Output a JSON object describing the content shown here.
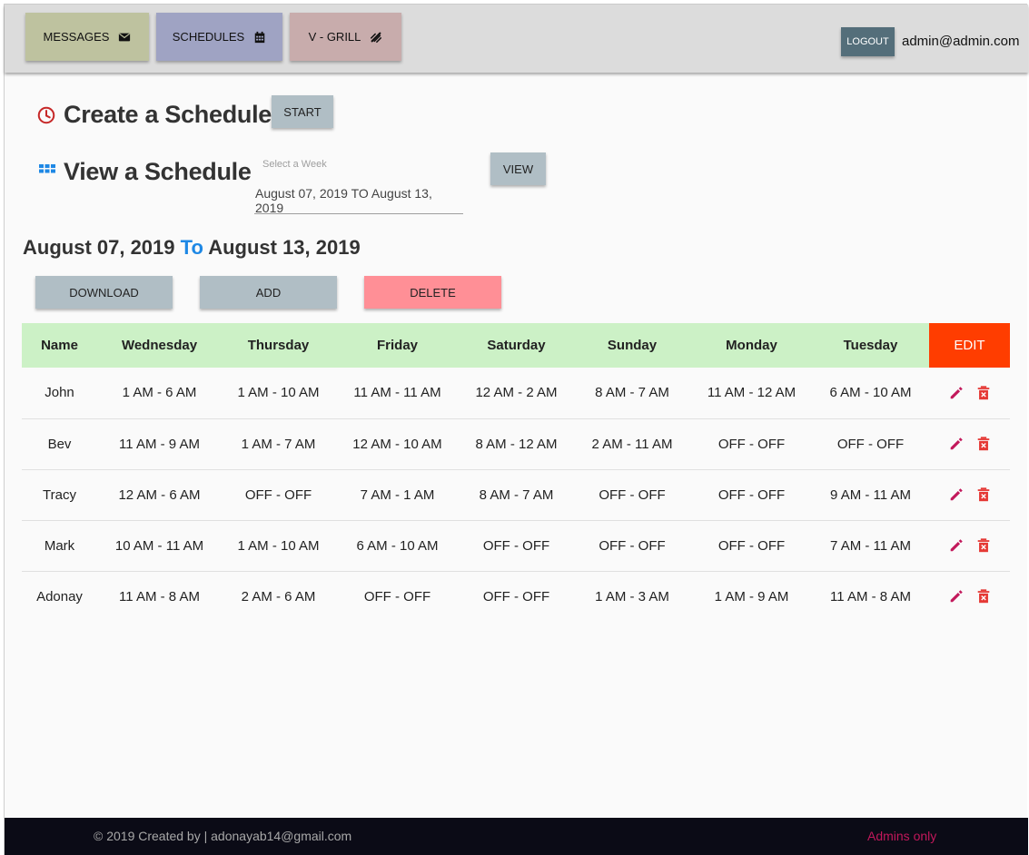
{
  "nav": {
    "messages_label": "MESSAGES",
    "schedules_label": "SCHEDULES",
    "vgrill_label": "V - GRILL",
    "logout_label": "LOGOUT",
    "user_email": "admin@admin.com"
  },
  "create": {
    "title": "Create a Schedule",
    "start_label": "START"
  },
  "view": {
    "title": "View a Schedule",
    "week_label": "Select a Week",
    "week_value": "August 07, 2019 TO August 13, 2019",
    "view_label": "VIEW"
  },
  "range": {
    "start": "August 07, 2019",
    "to": "To",
    "end": "August 13, 2019"
  },
  "actions": {
    "download_label": "DOWNLOAD",
    "add_label": "ADD",
    "delete_label": "DELETE"
  },
  "table": {
    "headers": [
      "Name",
      "Wednesday",
      "Thursday",
      "Friday",
      "Saturday",
      "Sunday",
      "Monday",
      "Tuesday",
      "EDIT"
    ],
    "rows": [
      [
        "John",
        "1 AM - 6 AM",
        "1 AM - 10 AM",
        "11 AM - 11 AM",
        "12 AM - 2 AM",
        "8 AM - 7 AM",
        "11 AM - 12 AM",
        "6 AM - 10 AM"
      ],
      [
        "Bev",
        "11 AM - 9 AM",
        "1 AM - 7 AM",
        "12 AM - 10 AM",
        "8 AM - 12 AM",
        "2 AM - 11 AM",
        "OFF - OFF",
        "OFF - OFF"
      ],
      [
        "Tracy",
        "12 AM - 6 AM",
        "OFF - OFF",
        "7 AM - 1 AM",
        "8 AM - 7 AM",
        "OFF - OFF",
        "OFF - OFF",
        "9 AM - 11 AM"
      ],
      [
        "Mark",
        "10 AM - 11 AM",
        "1 AM - 10 AM",
        "6 AM - 10 AM",
        "OFF - OFF",
        "OFF - OFF",
        "OFF - OFF",
        "7 AM - 11 AM"
      ],
      [
        "Adonay",
        "11 AM - 8 AM",
        "2 AM - 6 AM",
        "OFF - OFF",
        "OFF - OFF",
        "1 AM - 3 AM",
        "1 AM - 9 AM",
        "11 AM - 8 AM"
      ]
    ]
  },
  "footer": {
    "copyright": "© 2019 Created by | adonayab14@gmail.com",
    "admins": "Admins only"
  },
  "colors": {
    "messages_btn": "#bec29f",
    "schedules_btn": "#9fa3c3",
    "vgrill_btn": "#c8acac",
    "logout_btn": "#546e7a",
    "grey_btn": "#b0bec5",
    "delete_btn": "#ff8f96",
    "table_header": "#ccf1c6",
    "edit_header": "#ff3d00",
    "clock_icon": "#c62828",
    "grid_icon": "#1e88e5",
    "to_accent": "#1e88e5",
    "pencil_icon": "#c2185b",
    "trash_icon": "#e53935",
    "footer_bg": "#0b0b16",
    "admins_text": "#c2185b"
  },
  "icons": {
    "messages": "envelope-icon",
    "schedules": "calendar-icon",
    "vgrill": "grill-icon",
    "create": "clock-icon",
    "view": "grid-icon",
    "edit": "pencil-icon",
    "delete": "trash-icon"
  }
}
